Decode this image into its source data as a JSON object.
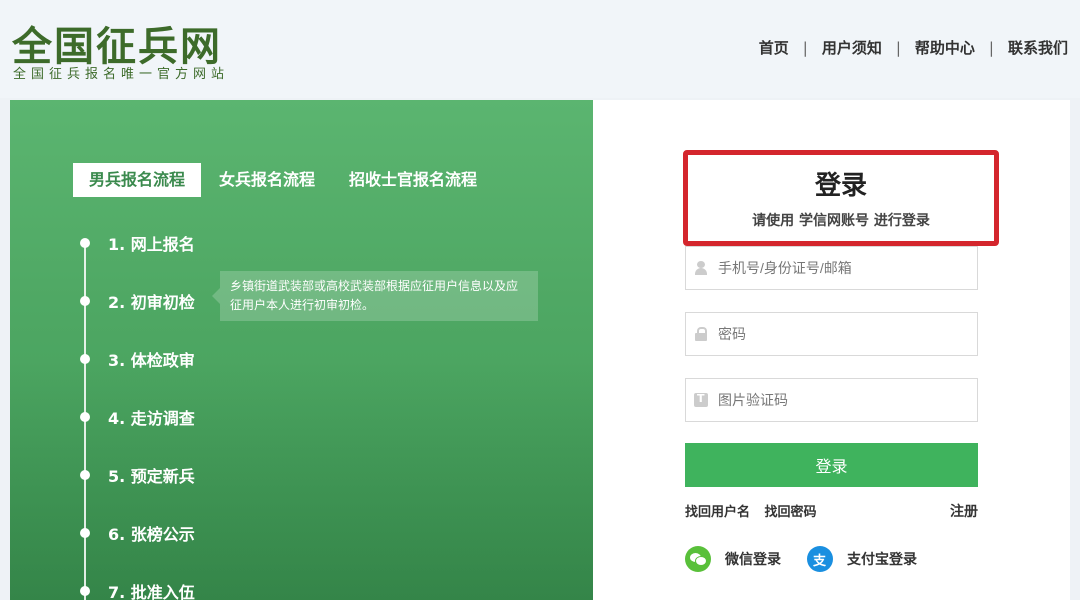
{
  "header": {
    "logo_title": "全国征兵网",
    "logo_subtitle": "全国征兵报名唯一官方网站",
    "nav": [
      "首页",
      "用户须知",
      "帮助中心",
      "联系我们"
    ],
    "separator": "|"
  },
  "process": {
    "tabs": [
      "男兵报名流程",
      "女兵报名流程",
      "招收士官报名流程"
    ],
    "active_tab": 0,
    "steps": [
      "1. 网上报名",
      "2. 初审初检",
      "3. 体检政审",
      "4. 走访调查",
      "5. 预定新兵",
      "6. 张榜公示",
      "7. 批准入伍"
    ],
    "tooltip": "乡镇街道武装部或高校武装部根据应征用户信息以及应征用户本人进行初审初检。"
  },
  "login": {
    "title": "登录",
    "subtitle": "请使用  学信网账号  进行登录",
    "username_placeholder": "手机号/身份证号/邮箱",
    "password_placeholder": "密码",
    "captcha_placeholder": "图片验证码",
    "submit_label": "登录",
    "find_username": "找回用户名",
    "find_password": "找回密码",
    "register": "注册",
    "wechat_login": "微信登录",
    "alipay_login": "支付宝登录"
  },
  "colors": {
    "brand_green": "#3fb35d",
    "panel_green": "#4fa864",
    "highlight_red": "#d4262d"
  },
  "icons": [
    "user-icon",
    "lock-icon",
    "captcha-icon",
    "wechat-icon",
    "alipay-icon"
  ]
}
